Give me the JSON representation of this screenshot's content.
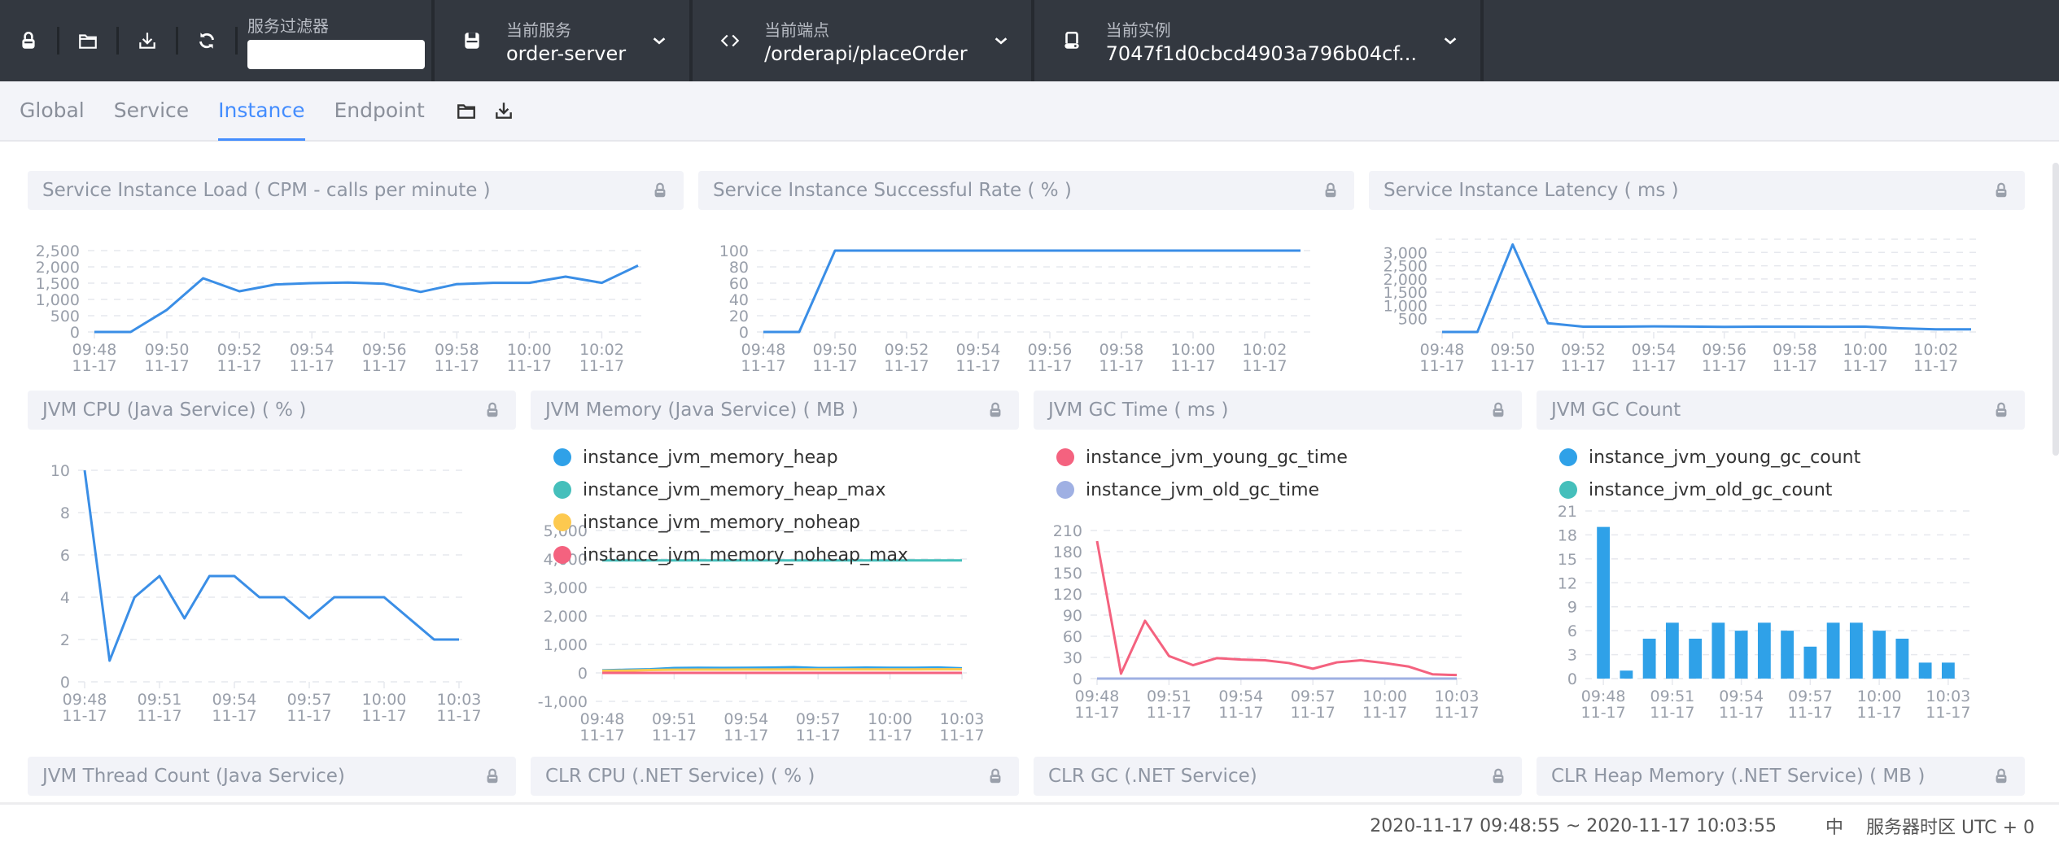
{
  "topbar": {
    "icons": [
      "lock-icon",
      "folder-icon",
      "download-icon",
      "refresh-icon"
    ],
    "filter": {
      "label": "服务过滤器",
      "value": "",
      "placeholder": ""
    },
    "service": {
      "label": "当前服务",
      "value": "order-server"
    },
    "endpoint": {
      "label": "当前端点",
      "value": "/orderapi/placeOrder"
    },
    "instance": {
      "label": "当前实例",
      "value": "7047f1d0cbcd4903a796b04cf..."
    }
  },
  "tabs": [
    {
      "label": "Global",
      "active": false
    },
    {
      "label": "Service",
      "active": false
    },
    {
      "label": "Instance",
      "active": true
    },
    {
      "label": "Endpoint",
      "active": false
    }
  ],
  "colors": {
    "accent": "#448dfe",
    "line": "#3a8ee6",
    "bar": "#2fa1e8"
  },
  "panels": {
    "load": "Service Instance Load ( CPM - calls per minute )",
    "success": "Service Instance Successful Rate ( % )",
    "latency": "Service Instance Latency ( ms )",
    "jvm_cpu": "JVM CPU (Java Service) ( % )",
    "jvm_mem": "JVM Memory (Java Service) ( MB )",
    "gc_time": "JVM GC Time ( ms )",
    "gc_count": "JVM GC Count",
    "thread": "JVM Thread Count (Java Service)",
    "clr_cpu": "CLR CPU (.NET Service) ( % )",
    "clr_gc": "CLR GC (.NET Service)",
    "clr_heap": "CLR Heap Memory (.NET Service) ( MB )"
  },
  "chart_data": [
    {
      "id": "load",
      "type": "line",
      "title": "Service Instance Load ( CPM - calls per minute )",
      "x": [
        "09:48",
        "09:49",
        "09:50",
        "09:51",
        "09:52",
        "09:53",
        "09:54",
        "09:55",
        "09:56",
        "09:57",
        "09:58",
        "09:59",
        "10:00",
        "10:01",
        "10:02",
        "10:03"
      ],
      "xticks": [
        "09:48",
        "09:50",
        "09:52",
        "09:54",
        "09:56",
        "09:58",
        "10:00",
        "10:02"
      ],
      "xdate": "11-17",
      "ylim": [
        0,
        2500
      ],
      "yticks": [
        0,
        500,
        1000,
        1500,
        2000,
        2500
      ],
      "series": [
        {
          "name": "load",
          "color": "#3a8ee6",
          "values": [
            0,
            0,
            680,
            1650,
            1250,
            1460,
            1500,
            1520,
            1480,
            1230,
            1470,
            1510,
            1510,
            1700,
            1510,
            2040
          ]
        }
      ]
    },
    {
      "id": "success",
      "type": "line",
      "title": "Service Instance Successful Rate ( % )",
      "x": [
        "09:48",
        "09:49",
        "09:50",
        "09:51",
        "09:52",
        "09:53",
        "09:54",
        "09:55",
        "09:56",
        "09:57",
        "09:58",
        "09:59",
        "10:00",
        "10:01",
        "10:02",
        "10:03"
      ],
      "xticks": [
        "09:48",
        "09:50",
        "09:52",
        "09:54",
        "09:56",
        "09:58",
        "10:00",
        "10:02"
      ],
      "xdate": "11-17",
      "ylim": [
        0,
        100
      ],
      "yticks": [
        0,
        20,
        40,
        60,
        80,
        100
      ],
      "series": [
        {
          "name": "success",
          "color": "#3a8ee6",
          "values": [
            0,
            0,
            100,
            100,
            100,
            100,
            100,
            100,
            100,
            100,
            100,
            100,
            100,
            100,
            100,
            100
          ]
        }
      ]
    },
    {
      "id": "latency",
      "type": "line",
      "title": "Service Instance Latency ( ms )",
      "x": [
        "09:48",
        "09:49",
        "09:50",
        "09:51",
        "09:52",
        "09:53",
        "09:54",
        "09:55",
        "09:56",
        "09:57",
        "09:58",
        "09:59",
        "10:00",
        "10:01",
        "10:02",
        "10:03"
      ],
      "xticks": [
        "09:48",
        "09:50",
        "09:52",
        "09:54",
        "09:56",
        "09:58",
        "10:00",
        "10:02"
      ],
      "xdate": "11-17",
      "ylim": [
        0,
        3500
      ],
      "yticks": [
        500,
        1000,
        1500,
        2000,
        2500,
        3000
      ],
      "gridlines": [
        0,
        500,
        1000,
        1500,
        2000,
        2500,
        3000,
        3500
      ],
      "series": [
        {
          "name": "latency",
          "color": "#3a8ee6",
          "values": [
            0,
            0,
            3300,
            330,
            200,
            200,
            210,
            205,
            190,
            200,
            200,
            195,
            200,
            140,
            100,
            100
          ]
        }
      ]
    },
    {
      "id": "jvm_cpu",
      "type": "line",
      "title": "JVM CPU (Java Service) ( % )",
      "x": [
        "09:48",
        "09:49",
        "09:50",
        "09:51",
        "09:52",
        "09:53",
        "09:54",
        "09:55",
        "09:56",
        "09:57",
        "09:58",
        "09:59",
        "10:00",
        "10:01",
        "10:02",
        "10:03"
      ],
      "xticks": [
        "09:48",
        "09:51",
        "09:54",
        "09:57",
        "10:00",
        "10:03"
      ],
      "xdate": "11-17",
      "ylim": [
        0,
        10
      ],
      "yticks": [
        0,
        2,
        4,
        6,
        8,
        10
      ],
      "series": [
        {
          "name": "cpu",
          "color": "#3a8ee6",
          "values": [
            10,
            1,
            4,
            5,
            3,
            5,
            5,
            4,
            4,
            3,
            4,
            4,
            4,
            3,
            2,
            2
          ]
        }
      ]
    },
    {
      "id": "jvm_mem",
      "type": "line",
      "title": "JVM Memory (Java Service) ( MB )",
      "x": [
        "09:48",
        "09:49",
        "09:50",
        "09:51",
        "09:52",
        "09:53",
        "09:54",
        "09:55",
        "09:56",
        "09:57",
        "09:58",
        "09:59",
        "10:00",
        "10:01",
        "10:02",
        "10:03"
      ],
      "xticks": [
        "09:48",
        "09:51",
        "09:54",
        "09:57",
        "10:00",
        "10:03"
      ],
      "xdate": "11-17",
      "ylim": [
        -1000,
        5000
      ],
      "yticks": [
        -1000,
        0,
        1000,
        2000,
        3000,
        4000,
        5000
      ],
      "legend": "top-left",
      "series": [
        {
          "name": "instance_jvm_memory_heap",
          "color": "#2fa1e8",
          "values": [
            90,
            110,
            130,
            170,
            180,
            175,
            180,
            185,
            200,
            170,
            175,
            185,
            180,
            180,
            190,
            160
          ]
        },
        {
          "name": "instance_jvm_memory_heap_max",
          "color": "#45bfbb",
          "values": [
            3950,
            3950,
            3950,
            3950,
            3950,
            3950,
            3950,
            3950,
            3950,
            3950,
            3950,
            3950,
            3950,
            3950,
            3950,
            3950
          ]
        },
        {
          "name": "instance_jvm_memory_noheap",
          "color": "#fdc94f",
          "values": [
            70,
            80,
            100,
            110,
            115,
            115,
            118,
            118,
            120,
            120,
            120,
            120,
            120,
            120,
            125,
            125
          ]
        },
        {
          "name": "instance_jvm_memory_noheap_max",
          "color": "#f4627f",
          "values": [
            -1,
            -1,
            -1,
            -1,
            -1,
            -1,
            -1,
            -1,
            -1,
            -1,
            -1,
            -1,
            -1,
            -1,
            -1,
            -1
          ]
        }
      ]
    },
    {
      "id": "gc_time",
      "type": "line",
      "title": "JVM GC Time ( ms )",
      "x": [
        "09:48",
        "09:49",
        "09:50",
        "09:51",
        "09:52",
        "09:53",
        "09:54",
        "09:55",
        "09:56",
        "09:57",
        "09:58",
        "09:59",
        "10:00",
        "10:01",
        "10:02",
        "10:03"
      ],
      "xticks": [
        "09:48",
        "09:51",
        "09:54",
        "09:57",
        "10:00",
        "10:03"
      ],
      "xdate": "11-17",
      "ylim": [
        0,
        210
      ],
      "yticks": [
        0,
        30,
        60,
        90,
        120,
        150,
        180,
        210
      ],
      "legend": "top-left",
      "series": [
        {
          "name": "instance_jvm_young_gc_time",
          "color": "#f4627f",
          "values": [
            195,
            7,
            82,
            32,
            19,
            29,
            27,
            26,
            22,
            14,
            23,
            26,
            22,
            17,
            6,
            5
          ]
        },
        {
          "name": "instance_jvm_old_gc_time",
          "color": "#9fb0e3",
          "values": [
            0,
            0,
            0,
            0,
            0,
            0,
            0,
            0,
            0,
            0,
            0,
            0,
            0,
            0,
            0,
            0
          ]
        }
      ]
    },
    {
      "id": "gc_count",
      "type": "bar",
      "title": "JVM GC Count",
      "x": [
        "09:48",
        "09:49",
        "09:50",
        "09:51",
        "09:52",
        "09:53",
        "09:54",
        "09:55",
        "09:56",
        "09:57",
        "09:58",
        "09:59",
        "10:00",
        "10:01",
        "10:02",
        "10:03"
      ],
      "xticks": [
        "09:48",
        "09:51",
        "09:54",
        "09:57",
        "10:00",
        "10:03"
      ],
      "xdate": "11-17",
      "ylim": [
        0,
        21
      ],
      "yticks": [
        0,
        3,
        6,
        9,
        12,
        15,
        18,
        21
      ],
      "legend": "top-left",
      "series": [
        {
          "name": "instance_jvm_young_gc_count",
          "color": "#2fa1e8",
          "values": [
            19,
            1,
            5,
            7,
            5,
            7,
            6,
            7,
            6,
            4,
            7,
            7,
            6,
            5,
            2,
            2
          ]
        },
        {
          "name": "instance_jvm_old_gc_count",
          "color": "#45bfbb",
          "values": [
            0,
            0,
            0,
            0,
            0,
            0,
            0,
            0,
            0,
            0,
            0,
            0,
            0,
            0,
            0,
            0
          ]
        }
      ]
    }
  ],
  "footer": {
    "time_range": "2020-11-17 09:48:55 ~ 2020-11-17 10:03:55",
    "language": "中",
    "timezone": "服务器时区 UTC + 0"
  }
}
